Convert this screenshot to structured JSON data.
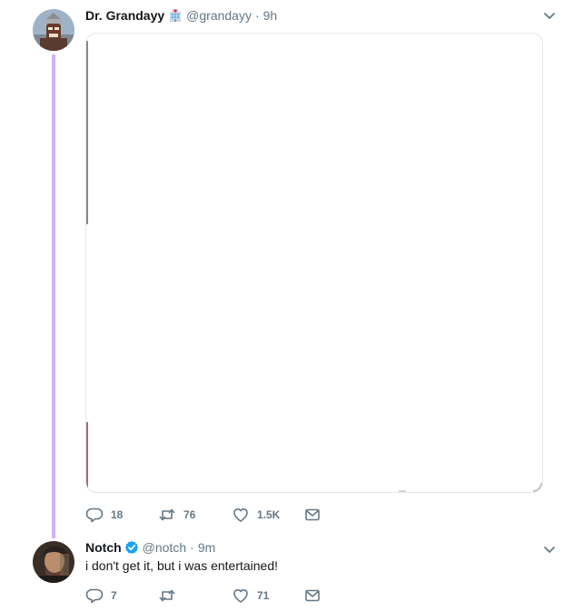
{
  "colors": {
    "thread_line": "#d5b0f4",
    "secondary_text": "#657786",
    "verified": "#1da1f2"
  },
  "tweet1": {
    "display_name": "Dr. Grandayy",
    "badge_icon": "hospital-emoji-icon",
    "handle": "@grandayy",
    "separator": "·",
    "time": "9h",
    "replies": "18",
    "retweets": "76",
    "likes": "1.5K"
  },
  "tweet2": {
    "display_name": "Notch",
    "verified_icon": "verified-badge-icon",
    "handle": "@notch",
    "separator": "·",
    "time": "9m",
    "text": "i don't get it, but i was entertained!",
    "replies": "7",
    "retweets": "",
    "likes": "71"
  }
}
